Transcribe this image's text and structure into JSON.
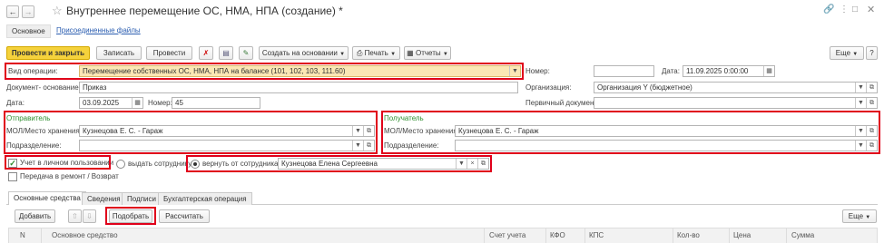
{
  "window": {
    "title": "Внутреннее перемещение ОС, НМА, НПА (создание) *",
    "star_icon": "star-icon",
    "link_icon": "link-icon",
    "more_icon": "more-vertical-icon",
    "maximize_icon": "maximize-icon",
    "close_icon": "close-icon"
  },
  "nav": {
    "tabs": [
      {
        "label": "Основное"
      },
      {
        "label": "Присоединенные файлы"
      }
    ]
  },
  "toolbar": {
    "post_close": "Провести и закрыть",
    "save": "Записать",
    "post": "Провести",
    "create_based": "Создать на основании",
    "print": "Печать",
    "reports": "Отчеты",
    "more": "Еще",
    "help": "?"
  },
  "form": {
    "operation_label": "Вид операции:",
    "operation_value": "Перемещение собственных ОС, НМА, НПА на балансе (101, 102, 103, 111.60)",
    "basis_label": "Документ- основание:",
    "basis_value": "Приказ",
    "date_label": "Дата:",
    "date_value": "03.09.2025",
    "number_label": "Номер:",
    "number_value": "45",
    "doc_number_label": "Номер:",
    "doc_number_value": "",
    "doc_date_label": "Дата:",
    "doc_date_value": "11.09.2025  0:00:00",
    "org_label": "Организация:",
    "org_value": "Организация Y (бюджетное)",
    "primary_doc_label": "Первичный документ:",
    "primary_doc_value": ""
  },
  "sender": {
    "title": "Отправитель",
    "mol_label": "МОЛ/Место хранения:",
    "mol_value": "Кузнецова Е. С. - Гараж",
    "dept_label": "Подразделение:",
    "dept_value": ""
  },
  "receiver": {
    "title": "Получатель",
    "mol_label": "МОЛ/Место хранения:",
    "mol_value": "Кузнецова Е. С. - Гараж",
    "dept_label": "Подразделение:",
    "dept_value": ""
  },
  "options": {
    "personal_use_label": "Учет в личном пользовании",
    "personal_use_checked": true,
    "repair_label": "Передача в ремонт / Возврат",
    "repair_checked": false,
    "issue_label": "выдать сотруднику:",
    "return_label": "вернуть от сотрудника:",
    "selected": "return",
    "employee_value": "Кузнецова Елена Сергеевна"
  },
  "tabs": [
    {
      "label": "Основные средства"
    },
    {
      "label": "Сведения"
    },
    {
      "label": "Подписи"
    },
    {
      "label": "Бухгалтерская операция"
    }
  ],
  "table_toolbar": {
    "add": "Добавить",
    "up_icon": "arrow-up-icon",
    "down_icon": "arrow-down-icon",
    "select": "Подобрать",
    "calculate": "Рассчитать",
    "more": "Еще"
  },
  "table": {
    "columns": [
      "N",
      "Основное средство",
      "Счет учета",
      "КФО",
      "КПС",
      "Кол-во",
      "Цена",
      "Сумма"
    ]
  },
  "colors": {
    "accent_yellow": "#f5d23c",
    "highlight_red": "#e0001a",
    "group_green": "#2f8f2f",
    "operation_bg": "#fbe7b5"
  }
}
